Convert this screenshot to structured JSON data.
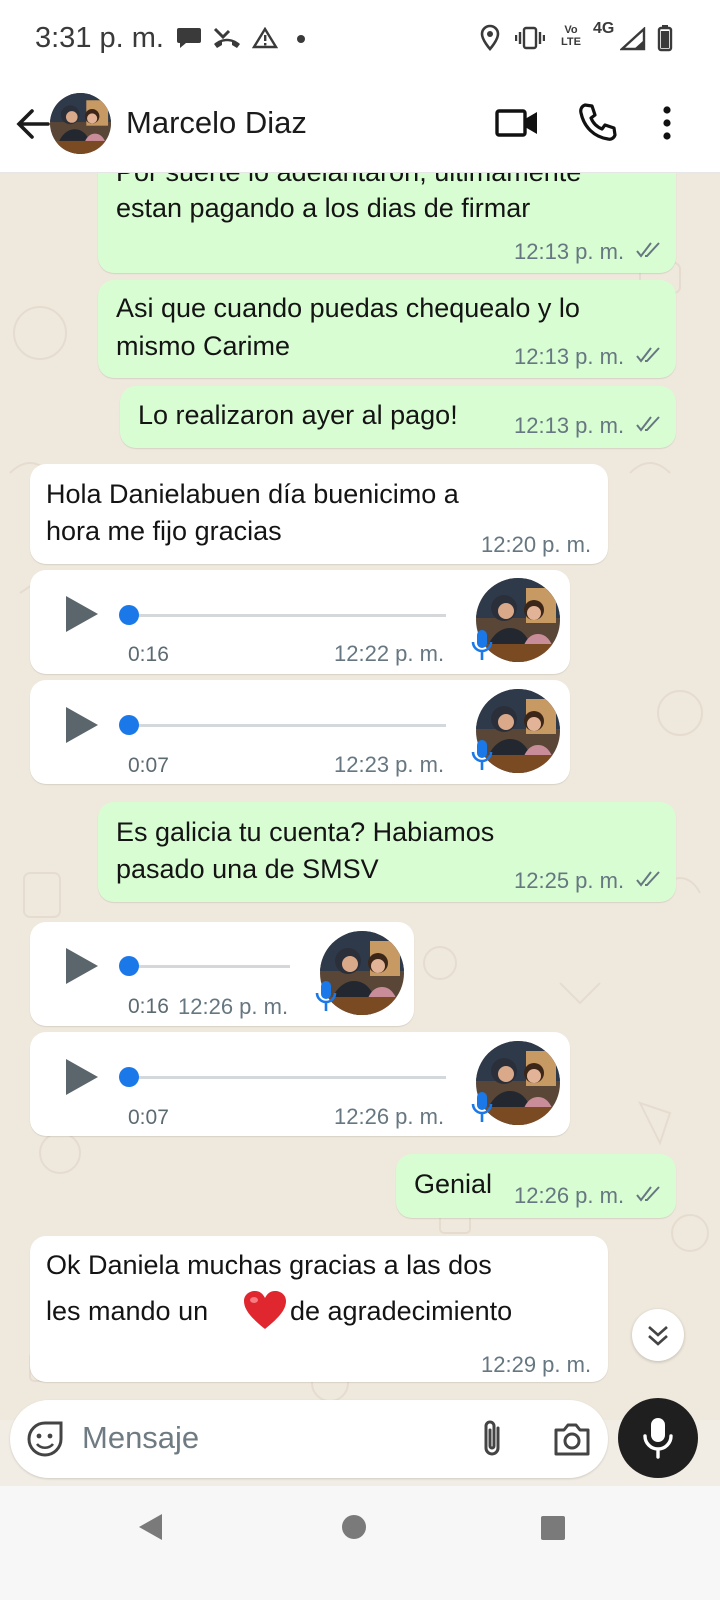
{
  "status_bar": {
    "time": "3:31 p. m.",
    "icons": [
      "chat-bubble-icon",
      "missed-call-icon",
      "warning-icon",
      "dot-icon",
      "location-icon",
      "vibrate-icon",
      "volte-icon",
      "4g-signal-icon",
      "battery-icon"
    ],
    "volte_label": "Vo LTE",
    "network_label": "4G"
  },
  "header": {
    "contact_name": "Marcelo Diaz",
    "actions": [
      "video-call-icon",
      "phone-call-icon",
      "more-options-icon"
    ]
  },
  "messages": [
    {
      "type": "text",
      "direction": "out",
      "lines": [
        "Por suerte lo adelantaron, ultimamente",
        "estan pagando a los dias de firmar"
      ],
      "time": "12:13 p. m.",
      "read": true
    },
    {
      "type": "text",
      "direction": "out",
      "lines": [
        "Asi que cuando puedas chequealo y lo",
        "mismo Carime"
      ],
      "time": "12:13 p. m.",
      "read": true
    },
    {
      "type": "text",
      "direction": "out",
      "lines": [
        "Lo realizaron ayer al pago!"
      ],
      "time": "12:13 p. m.",
      "read": true
    },
    {
      "type": "text",
      "direction": "in",
      "lines": [
        "Hola Danielabuen día  buenicimo a",
        "hora me fijo gracias"
      ],
      "time": "12:20 p. m."
    },
    {
      "type": "voice",
      "direction": "in",
      "duration": "0:16",
      "time": "12:22 p. m."
    },
    {
      "type": "voice",
      "direction": "in",
      "duration": "0:07",
      "time": "12:23 p. m."
    },
    {
      "type": "text",
      "direction": "out",
      "lines": [
        "Es galicia tu cuenta? Habiamos",
        "pasado una de SMSV"
      ],
      "time": "12:25 p. m.",
      "read": true
    },
    {
      "type": "voice",
      "direction": "in",
      "duration": "0:16",
      "time": "12:26 p. m."
    },
    {
      "type": "voice",
      "direction": "in",
      "duration": "0:07",
      "time": "12:26 p. m."
    },
    {
      "type": "text",
      "direction": "out",
      "lines": [
        "Genial"
      ],
      "time": "12:26 p. m.",
      "read": true
    },
    {
      "type": "text",
      "direction": "in",
      "lines": [
        "Ok Daniela muchas gracias a las dos",
        "les mando un",
        "de agradecimiento"
      ],
      "emoji": "heart-emoji",
      "time": "12:29 p. m."
    }
  ],
  "composer": {
    "placeholder": "Mensaje",
    "icons": [
      "emoji-sticker-icon",
      "attach-icon",
      "camera-icon",
      "microphone-icon"
    ]
  },
  "nav_bar": {
    "buttons": [
      "back-triangle-icon",
      "home-circle-icon",
      "recents-square-icon"
    ]
  },
  "colors": {
    "outgoing_bubble": "#d9fdd3",
    "incoming_bubble": "#ffffff",
    "chat_background": "#efe8dc",
    "voice_dot": "#1a78e8",
    "read_ticks": "#667781"
  }
}
